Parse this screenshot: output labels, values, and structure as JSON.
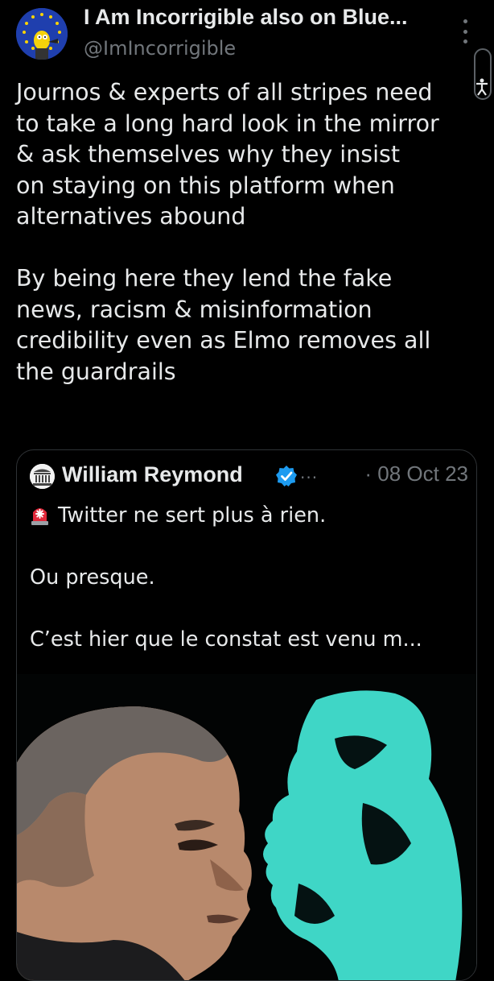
{
  "author": {
    "display_name": "I Am Incorrigible also on Blue...",
    "handle": "@ImIncorrigible",
    "avatar": "simpsons-character-eu-flag-avatar"
  },
  "tweet": {
    "paragraphs": [
      [
        "Journos & experts of all stripes need",
        "to take a long hard look in the mirror",
        "& ask themselves why they insist",
        "on staying on this platform when",
        "alternatives abound"
      ],
      [
        "By being here they lend the fake",
        "news, racism & misinformation",
        "credibility even as Elmo removes all",
        "the guardrails"
      ]
    ]
  },
  "quoted_tweet": {
    "display_name": "William Reymond",
    "verified": true,
    "ellipsis": "...",
    "date": "· 08 Oct 23",
    "lines": [
      "Twitter ne sert plus à rien.",
      "Ou presque.",
      "C’est hier que le constat est venu m..."
    ],
    "siren_icon": "rotating-light-emoji",
    "media": "photo-profile-portrait-with-cyan-silhouette"
  },
  "colors": {
    "background": "#000000",
    "text": "#e7e9ea",
    "secondary": "#71767b",
    "border": "#2f3336",
    "verified": "#1d9bf0",
    "accent_cyan": "#3fd6c6"
  }
}
